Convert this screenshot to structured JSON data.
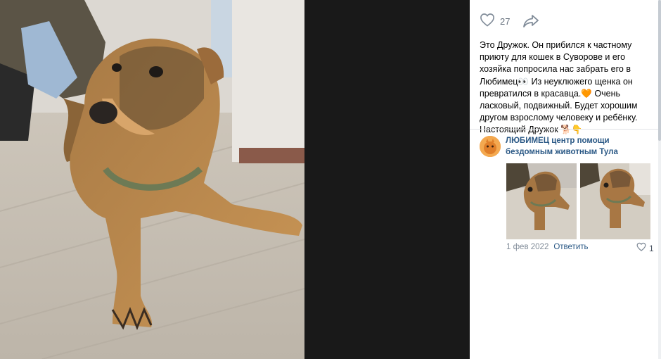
{
  "post": {
    "likes": "27",
    "text": "Это Дружок. Он прибился к частному приюту для кошек в Суворове и его хозяйка попросила нас забрать его в Любимец👀 Из неуклюжего щенка он превратился в красавца.🧡 Очень ласковый, подвижный. Будет хорошим другом взрослому человеку и ребёнку. Настоящий Дружок 🐕👇"
  },
  "comment": {
    "author": "ЛЮБИМЕЦ центр помощи бездомным животным Тула",
    "date": "1 фев 2022",
    "reply_label": "Ответить",
    "likes": "1"
  },
  "icons": {
    "like": "heart-outline-icon",
    "share": "share-arrow-icon"
  },
  "colors": {
    "link": "#2a5885",
    "muted": "#818c99",
    "icon": "#818c99",
    "viewer_bg": "#191919"
  }
}
